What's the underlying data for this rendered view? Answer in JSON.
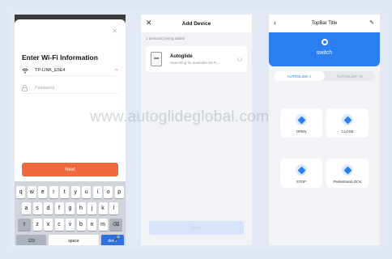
{
  "wifi_screen": {
    "title": "Enter Wi-Fi Information",
    "ssid": "TP-LINK_E5E4",
    "ssid_action": "⇆",
    "password_placeholder": "Password",
    "next_label": "Next",
    "keyboard": {
      "row1": [
        "q",
        "w",
        "e",
        "r",
        "t",
        "y",
        "u",
        "i",
        "o",
        "p"
      ],
      "row2": [
        "a",
        "s",
        "d",
        "f",
        "g",
        "h",
        "j",
        "k",
        "l"
      ],
      "row3": [
        "z",
        "x",
        "c",
        "v",
        "b",
        "n",
        "m"
      ],
      "shift": "⇧",
      "delete": "⌫",
      "num_label": "123",
      "space_label": "space",
      "done_label": "done",
      "mic": "🎤"
    }
  },
  "add_device_screen": {
    "title": "Add Device",
    "close_glyph": "✕",
    "added_text": "1 device(s) being added",
    "device_name": "Autoglide",
    "device_status": "Searching for available Wi-Fi...",
    "done_label": "Done"
  },
  "control_screen": {
    "title": "TopBar Title",
    "back_glyph": "‹",
    "edit_glyph": "✎",
    "banner_label": "switch",
    "tabs": [
      "AUTOSLIDE-J",
      "AUTOSLIDE -W"
    ],
    "controls": [
      "OPEN",
      "CLOSE",
      "STOP",
      "Pedestrian/LOCK"
    ]
  },
  "watermark": "www.autoglideglobal.com"
}
